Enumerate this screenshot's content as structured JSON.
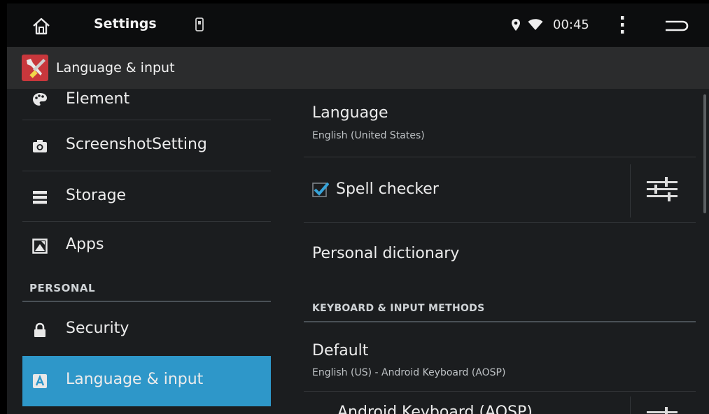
{
  "statusbar": {
    "title": "Settings",
    "time": "00:45",
    "icons": [
      "home-icon",
      "sd-card-icon",
      "location-icon",
      "wifi-icon",
      "overflow-menu-icon",
      "back-icon"
    ]
  },
  "actionbar": {
    "title": "Language & input",
    "icon": "settings-tools-icon"
  },
  "left": {
    "items": [
      {
        "label": "Element",
        "icon": "palette-icon"
      },
      {
        "label": "ScreenshotSetting",
        "icon": "camera-icon"
      },
      {
        "label": "Storage",
        "icon": "storage-icon"
      },
      {
        "label": "Apps",
        "icon": "apps-icon"
      }
    ],
    "section": "PERSONAL",
    "personal_items": [
      {
        "label": "Security",
        "icon": "lock-icon"
      },
      {
        "label": "Language & input",
        "icon": "keyboard-a-icon",
        "selected": true
      }
    ]
  },
  "right": {
    "language": {
      "title": "Language",
      "value": "English (United States)"
    },
    "spell_checker": {
      "title": "Spell checker",
      "checked": true
    },
    "personal_dictionary": {
      "title": "Personal dictionary"
    },
    "keyboard_section": "KEYBOARD & INPUT METHODS",
    "default": {
      "title": "Default",
      "value": "English (US) - Android Keyboard (AOSP)"
    },
    "android_keyboard": {
      "title": "Android Keyboard (AOSP)"
    }
  },
  "colors": {
    "accent": "#2e97c9",
    "checkbox": "#36a3d9",
    "background": "#1b1d1f"
  }
}
